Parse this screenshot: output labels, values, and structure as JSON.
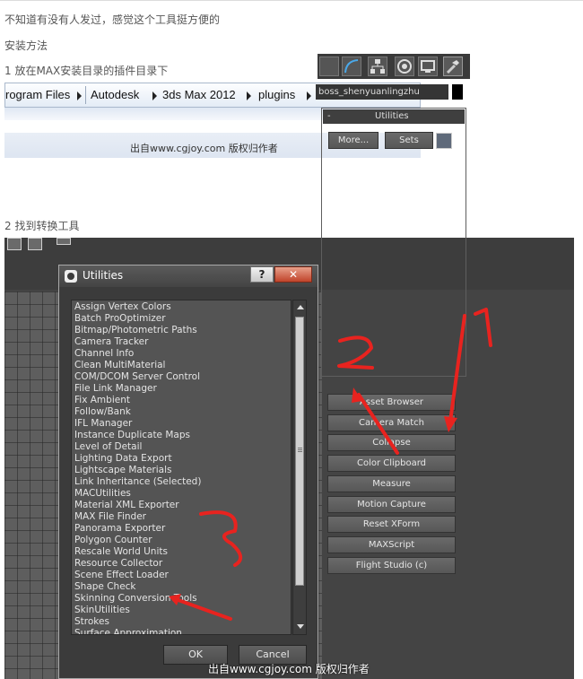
{
  "paragraphs": {
    "intro": "不知道有没有人发过，感觉这个工具挺方便的",
    "install_heading": "安装方法",
    "step1": "1 放在MAX安装目录的插件目录下",
    "step2": "2 找到转换工具"
  },
  "explorer": {
    "breadcrumb": [
      "rogram Files",
      "Autodesk",
      "3ds Max 2012",
      "plugins"
    ],
    "watermark": "出自www.cgjoy.com 版权归作者"
  },
  "max": {
    "object_name": "boss_shenyuanlingzhu",
    "rollout_title": "Utilities",
    "rollout_toggle": "-",
    "more_button": "More...",
    "sets_button": "Sets",
    "utility_buttons": [
      "Asset Browser",
      "Camera Match",
      "Collapse",
      "Color Clipboard",
      "Measure",
      "Motion Capture",
      "Reset XForm",
      "MAXScript",
      "Flight Studio (c)"
    ],
    "annotations": [
      "1",
      "2",
      "3"
    ],
    "colors": {
      "viewport": "#5e5e5e",
      "panel": "#444444",
      "annotation": "#e8231f"
    }
  },
  "dialog": {
    "title": "Utilities",
    "help_glyph": "?",
    "close_glyph": "✕",
    "items": [
      "Assign Vertex Colors",
      "Batch ProOptimizer",
      "Bitmap/Photometric Paths",
      "Camera Tracker",
      "Channel Info",
      "Clean MultiMaterial",
      "COM/DCOM Server Control",
      "File Link Manager",
      "Fix Ambient",
      "Follow/Bank",
      "IFL Manager",
      "Instance Duplicate Maps",
      "Level of Detail",
      "Lighting Data Export",
      "Lightscape Materials",
      "Link Inheritance (Selected)",
      "MACUtilities",
      "Material XML Exporter",
      "MAX File Finder",
      "Panorama Exporter",
      "Polygon Counter",
      "Rescale World Units",
      "Resource Collector",
      "Scene Effect Loader",
      "Shape Check",
      "Skinning Conversion Tools",
      "SkinUtilities",
      "Strokes",
      "Surface Approximation"
    ],
    "ok_label": "OK",
    "cancel_label": "Cancel"
  },
  "footer_watermark": "出自www.cgjoy.com 版权归作者"
}
